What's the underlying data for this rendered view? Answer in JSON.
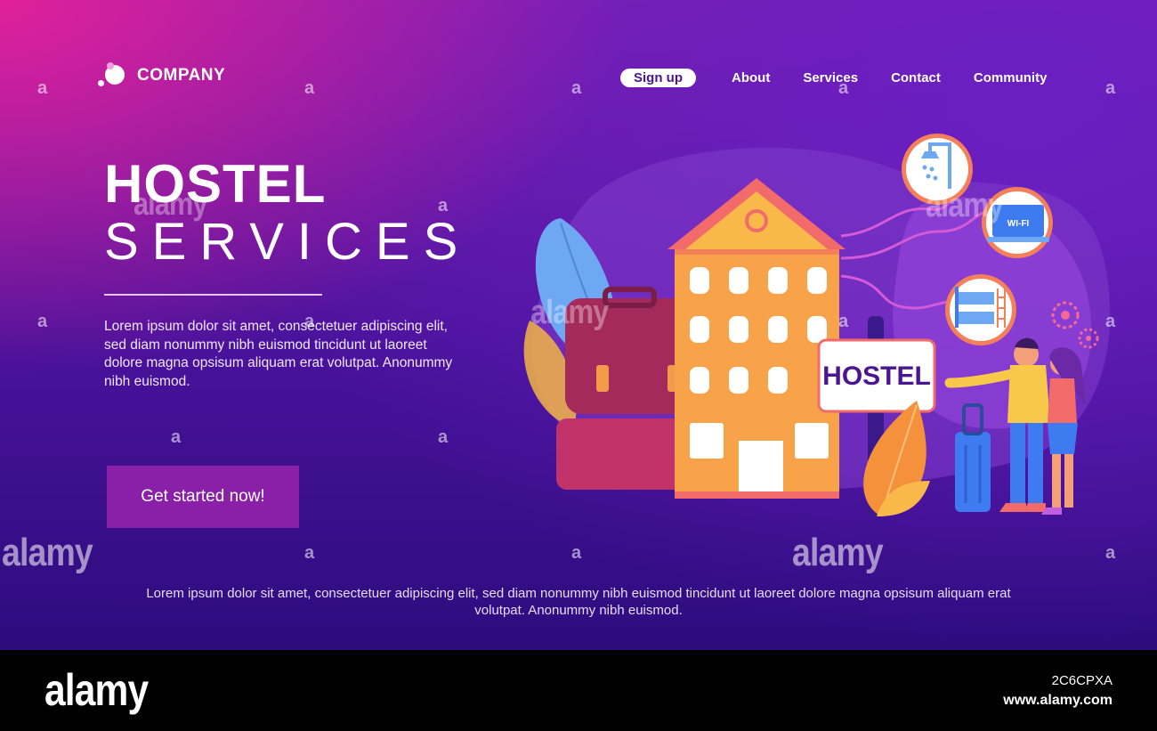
{
  "header": {
    "logo_text": "COMPANY",
    "nav": {
      "signup": "Sign up",
      "about": "About",
      "services": "Services",
      "contact": "Contact",
      "community": "Community"
    }
  },
  "hero": {
    "title_line1": "HOSTEL",
    "title_line2": "SERVICES",
    "description": "Lorem ipsum dolor sit amet, consectetuer adipiscing elit, sed diam nonummy nibh euismod tincidunt ut laoreet dolore magna opsisum aliquam erat volutpat. Anonummy nibh euismod.",
    "cta_label": "Get started now!"
  },
  "illustration": {
    "sign_text": "HOSTEL",
    "wifi_text": "WI-FI",
    "icons": [
      "shower-icon",
      "wifi-laptop-icon",
      "bunk-bed-icon",
      "gear-icon"
    ]
  },
  "footer": {
    "text": "Lorem ipsum dolor sit amet, consectetuer adipiscing elit, sed diam nonummy nibh euismod tincidunt ut laoreet dolore magna opsisum aliquam erat volutpat. Anonummy nibh euismod."
  },
  "watermark": {
    "brand": "alamy",
    "small": "a",
    "image_id": "2C6CPXA",
    "url": "www.alamy.com"
  },
  "colors": {
    "accent": "#8a1fa8",
    "building": "#f8b94a",
    "roof": "#f36a6a",
    "background_top": "#e0209a",
    "background_bottom": "#2d0c7e"
  }
}
